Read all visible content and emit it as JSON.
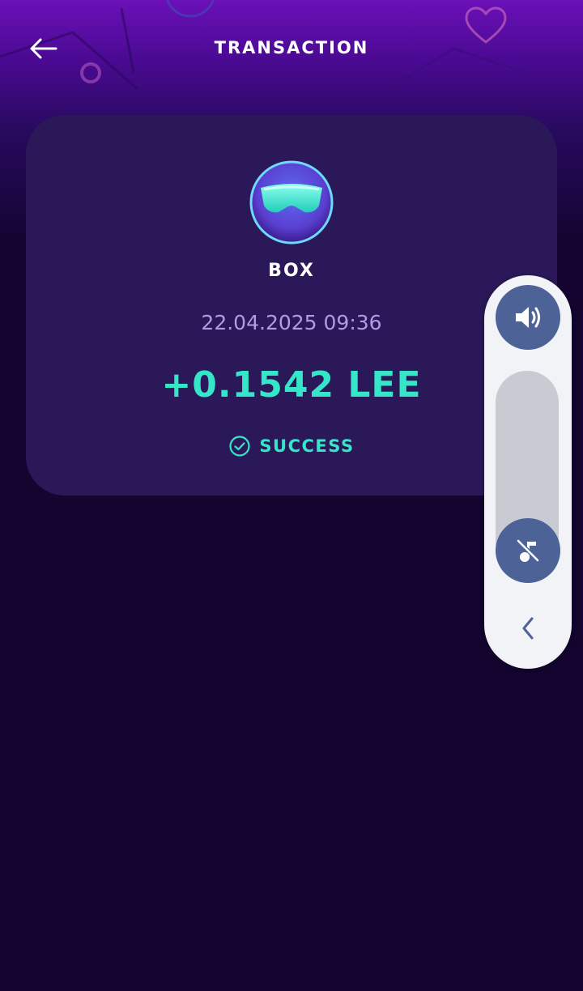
{
  "header": {
    "title": "TRANSACTION",
    "back_icon": "arrow-left-icon",
    "decorations": [
      "heart-icon",
      "circle-icon"
    ]
  },
  "transaction": {
    "avatar_icon": "box-avatar-glasses",
    "name": "BOX",
    "date": "22.04.2025 09:36",
    "amount": "+0.1542 LEE",
    "status_icon": "check-circle-icon",
    "status": "SUCCESS"
  },
  "volume_panel": {
    "speaker_icon": "speaker-icon",
    "mute_icon": "music-off-icon",
    "collapse_icon": "chevron-left-icon",
    "level": 0.0
  },
  "colors": {
    "background": "#140430",
    "header_top": "#6a10b8",
    "card": "#2a1858",
    "accent": "#35e7c8",
    "date": "#b49ae6",
    "panel": "#f2f3f7",
    "panel_button": "#4d6296"
  }
}
